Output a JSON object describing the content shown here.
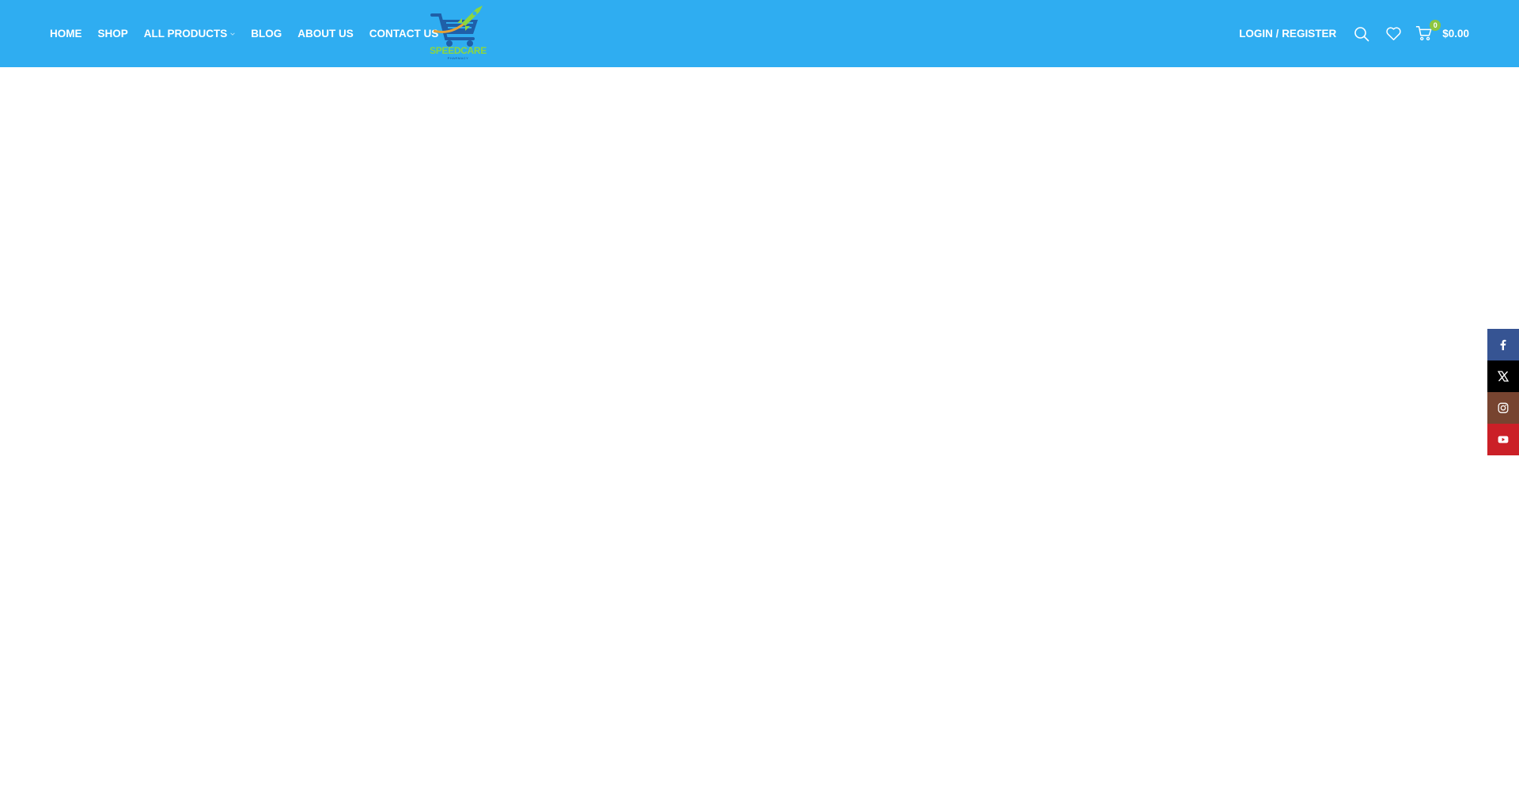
{
  "nav": {
    "items": [
      {
        "label": "HOME"
      },
      {
        "label": "SHOP"
      },
      {
        "label": "ALL PRODUCTS",
        "has_dropdown": true
      },
      {
        "label": "BLOG"
      },
      {
        "label": "ABOUT US"
      },
      {
        "label": "CONTACT US"
      }
    ]
  },
  "logo": {
    "brand": "SPEEDCARE",
    "sub": "PHARMACY"
  },
  "header_right": {
    "login_label": "LOGIN / REGISTER",
    "cart_count": "0",
    "cart_total": "$0.00"
  },
  "social": [
    {
      "icon": "facebook-icon"
    },
    {
      "icon": "x-icon"
    },
    {
      "icon": "instagram-icon"
    },
    {
      "icon": "youtube-icon"
    }
  ],
  "colors": {
    "header_bg": "#2fadf1",
    "accent_green": "#8cc63f",
    "facebook": "#365493",
    "x": "#000000",
    "instagram": "#774430",
    "youtube": "#cb2027"
  }
}
